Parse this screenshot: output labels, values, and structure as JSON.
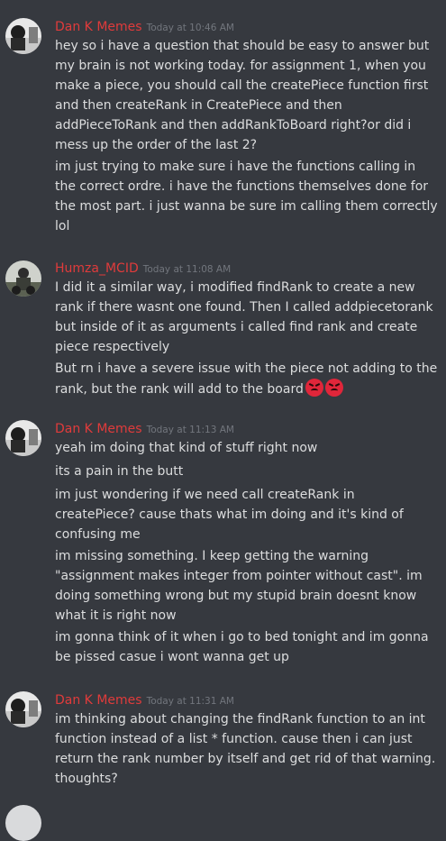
{
  "groups": [
    {
      "username": "Dan K Memes",
      "timestamp": "Today at 10:46 AM",
      "messages": [
        "hey so i have a question that should be easy to answer but my brain is not working today. for assignment 1, when you make a piece, you should call the createPiece function first and then createRank in CreatePiece and then addPieceToRank and then addRankToBoard right?or did i mess up the order of the last 2?",
        "im just trying to make sure i have the functions calling in the correct ordre. i have the functions themselves done for the most part. i just wanna be sure im calling them correctly lol"
      ]
    },
    {
      "username": "Humza_MCID",
      "timestamp": "Today at 11:08 AM",
      "messages": [
        "I did it a similar way, i modified findRank to create a new rank if there wasnt one found. Then I called addpiecetorank but inside of it as arguments i called find rank and create piece respectively",
        "But rn i have a severe issue with the piece not adding to the rank, but the rank will add to the board"
      ],
      "emojis": [
        "rage-emoji",
        "rage-emoji"
      ]
    },
    {
      "username": "Dan K Memes",
      "timestamp": "Today at 11:13 AM",
      "messages": [
        "yeah im doing that kind of stuff right now",
        "its a pain in the butt",
        "im just wondering if we need call createRank in createPiece? cause thats what im doing and it's kind of confusing me",
        "im missing something. I keep getting the warning \"assignment makes integer from pointer without cast\". im doing something wrong but my stupid brain doesnt know what it is right now",
        "im gonna think of it when i go to bed tonight and im gonna be pissed casue i wont wanna get up"
      ]
    },
    {
      "username": "Dan K Memes",
      "timestamp": "Today at 11:31 AM",
      "messages": [
        "im thinking about changing the findRank function to  an int function instead of a list * function. cause then i can just return the rank number by itself and get rid of that warning. thoughts?"
      ]
    }
  ],
  "colors": {
    "background": "#36393f",
    "username": "#e03b3b",
    "text": "#dcddde",
    "timestamp": "#72767d"
  }
}
